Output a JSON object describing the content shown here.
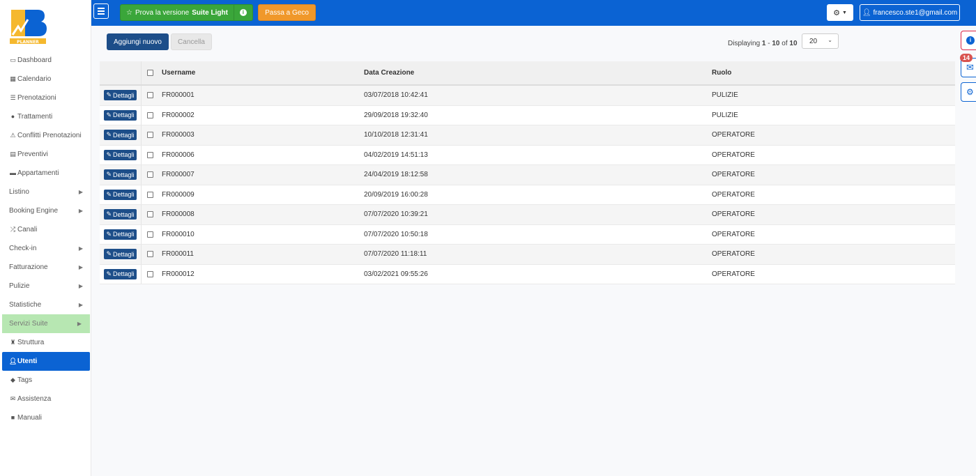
{
  "colors": {
    "brand": "#0b63d3",
    "success": "#3aa63a",
    "warning": "#f0982a",
    "primary_dark": "#1d4e89"
  },
  "sidebar": {
    "logo_text": "PLANNER",
    "items": [
      {
        "label": "Dashboard",
        "icon": "monitor-icon"
      },
      {
        "label": "Calendario",
        "icon": "calendar-icon"
      },
      {
        "label": "Prenotazioni",
        "icon": "list-icon"
      },
      {
        "label": "Trattamenti",
        "icon": "apple-icon"
      },
      {
        "label": "Conflitti Prenotazioni",
        "icon": "warning-icon"
      },
      {
        "label": "Preventivi",
        "icon": "document-icon"
      },
      {
        "label": "Appartamenti",
        "icon": "bed-icon"
      },
      {
        "label": "Listino",
        "icon": ""
      },
      {
        "label": "Booking Engine",
        "icon": ""
      },
      {
        "label": "Canali",
        "icon": "shuffle-icon"
      },
      {
        "label": "Check-in",
        "icon": ""
      },
      {
        "label": "Fatturazione",
        "icon": ""
      },
      {
        "label": "Pulizie",
        "icon": ""
      },
      {
        "label": "Statistiche",
        "icon": ""
      },
      {
        "label": "Servizi Suite",
        "icon": ""
      },
      {
        "label": "Struttura",
        "icon": "building-icon"
      },
      {
        "label": "Utenti",
        "icon": "user-icon"
      },
      {
        "label": "Tags",
        "icon": "tags-icon"
      },
      {
        "label": "Assistenza",
        "icon": "envelope-icon"
      },
      {
        "label": "Manuali",
        "icon": "book-icon"
      }
    ]
  },
  "topbar": {
    "trial_prefix": "Prova la versione ",
    "trial_bold": "Suite Light",
    "geco_label": "Passa a Geco",
    "user_email": "francesco.ste1@gmail.com"
  },
  "toolbar": {
    "add_label": "Aggiungi nuovo",
    "delete_label": "Cancella",
    "displaying_prefix": "Displaying ",
    "range_from": "1",
    "range_sep": " - ",
    "range_to": "10",
    "of_label": " of ",
    "total": "10",
    "page_size": "20"
  },
  "table": {
    "headers": {
      "username": "Username",
      "created": "Data Creazione",
      "role": "Ruolo"
    },
    "details_label": "Dettagli",
    "rows": [
      {
        "username": "FR000001",
        "created": "03/07/2018 10:42:41",
        "role": "PULIZIE"
      },
      {
        "username": "FR000002",
        "created": "29/09/2018 19:32:40",
        "role": "PULIZIE"
      },
      {
        "username": "FR000003",
        "created": "10/10/2018 12:31:41",
        "role": "OPERATORE"
      },
      {
        "username": "FR000006",
        "created": "04/02/2019 14:51:13",
        "role": "OPERATORE"
      },
      {
        "username": "FR000007",
        "created": "24/04/2019 18:12:58",
        "role": "OPERATORE"
      },
      {
        "username": "FR000009",
        "created": "20/09/2019 16:00:28",
        "role": "OPERATORE"
      },
      {
        "username": "FR000008",
        "created": "07/07/2020 10:39:21",
        "role": "OPERATORE"
      },
      {
        "username": "FR000010",
        "created": "07/07/2020 10:50:18",
        "role": "OPERATORE"
      },
      {
        "username": "FR000011",
        "created": "07/07/2020 11:18:11",
        "role": "OPERATORE"
      },
      {
        "username": "FR000012",
        "created": "03/02/2021 09:55:26",
        "role": "OPERATORE"
      }
    ]
  },
  "widgets": {
    "mail_badge": "14"
  }
}
